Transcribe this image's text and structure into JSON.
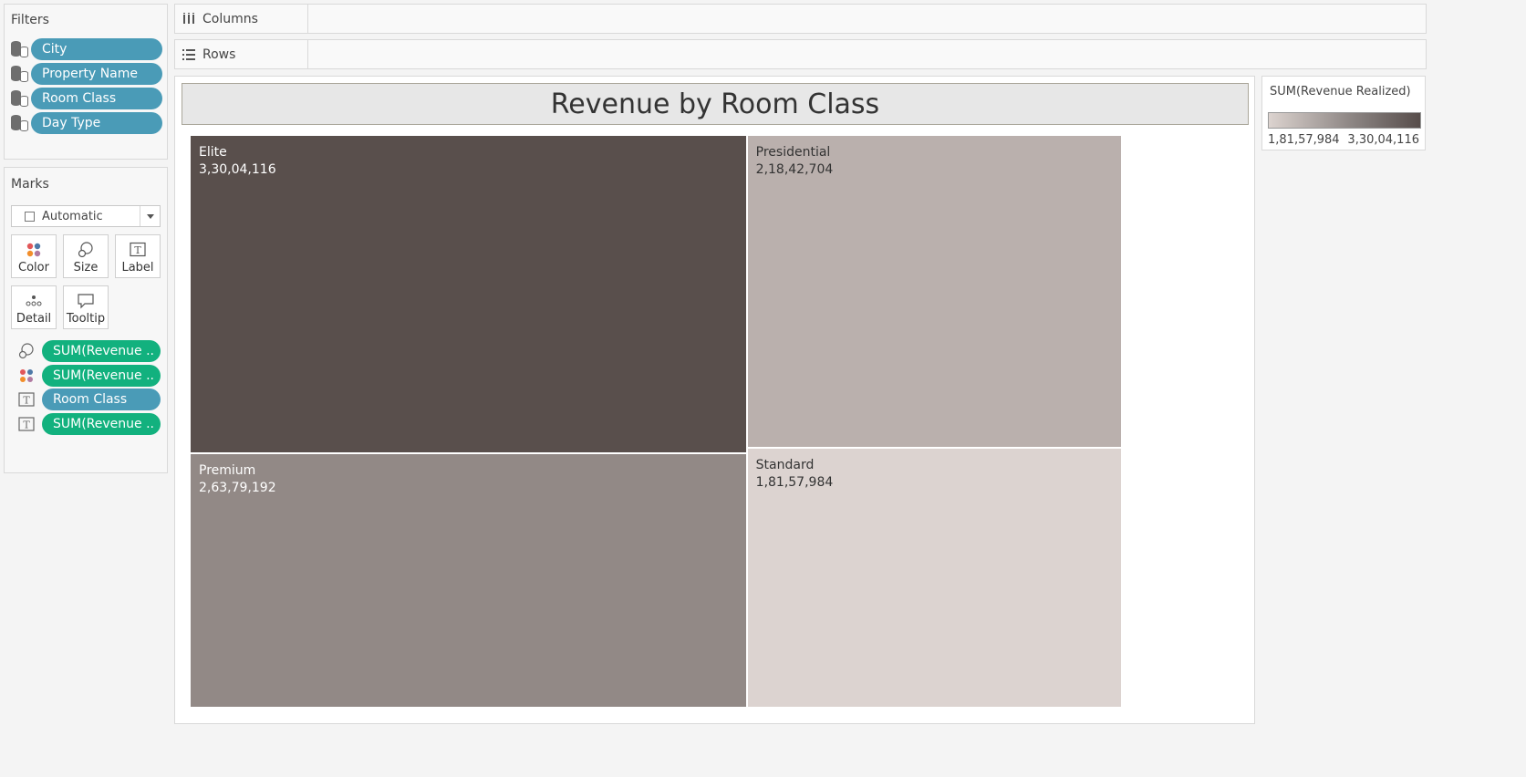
{
  "filters": {
    "title": "Filters",
    "items": [
      {
        "label": "City"
      },
      {
        "label": "Property Name"
      },
      {
        "label": "Room Class"
      },
      {
        "label": "Day Type"
      }
    ]
  },
  "marks": {
    "title": "Marks",
    "mark_type": "Automatic",
    "buttons": {
      "color": "Color",
      "size": "Size",
      "label": "Label",
      "detail": "Detail",
      "tooltip": "Tooltip"
    },
    "shelf": [
      {
        "icon": "size-icon",
        "label": "SUM(Revenue ..",
        "kind": "measure"
      },
      {
        "icon": "color-icon",
        "label": "SUM(Revenue ..",
        "kind": "measure"
      },
      {
        "icon": "label-icon",
        "label": "Room Class",
        "kind": "dimension"
      },
      {
        "icon": "label-icon",
        "label": "SUM(Revenue ..",
        "kind": "measure"
      }
    ]
  },
  "shelves": {
    "columns": "Columns",
    "rows": "Rows"
  },
  "legend": {
    "title": "SUM(Revenue Realized)",
    "min_label": "1,81,57,984",
    "max_label": "3,30,04,116",
    "colors": {
      "low": "#dcd3cf",
      "high": "#574d4b"
    }
  },
  "chart_data": {
    "type": "treemap",
    "title": "Revenue by Room Class",
    "items": [
      {
        "name": "Elite",
        "value": 33004116,
        "label": "3,30,04,116",
        "color": "#594f4c",
        "text_color": "#ffffff"
      },
      {
        "name": "Premium",
        "value": 26379192,
        "label": "2,63,79,192",
        "color": "#928986",
        "text_color": "#ffffff"
      },
      {
        "name": "Presidential",
        "value": 21842704,
        "label": "2,18,42,704",
        "color": "#bab0ad",
        "text_color": "#333333"
      },
      {
        "name": "Standard",
        "value": 18157984,
        "label": "1,81,57,984",
        "color": "#dcd3d0",
        "text_color": "#333333"
      }
    ]
  }
}
